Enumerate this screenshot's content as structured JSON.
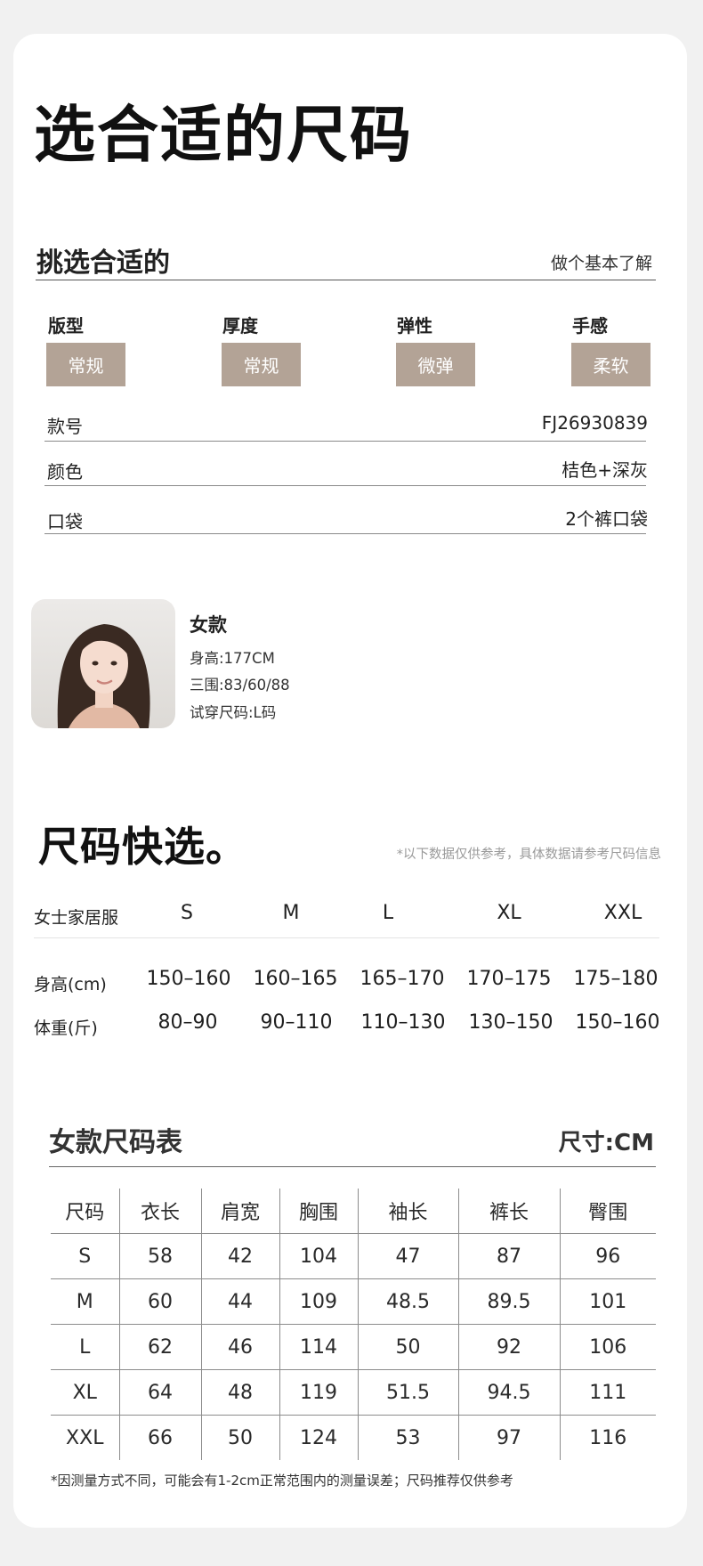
{
  "title": "选合适的尺码",
  "section": {
    "title": "挑选合适的",
    "link": "做个基本了解"
  },
  "attributes": [
    {
      "label": "版型",
      "value": "常规"
    },
    {
      "label": "厚度",
      "value": "常规"
    },
    {
      "label": "弹性",
      "value": "微弹"
    },
    {
      "label": "手感",
      "value": "柔软"
    }
  ],
  "specs": [
    {
      "label": "款号",
      "value": "FJ26930839"
    },
    {
      "label": "颜色",
      "value": "桔色+深灰"
    },
    {
      "label": "口袋",
      "value": "2个裤口袋"
    }
  ],
  "model": {
    "name": "女款",
    "height": "身高:177CM",
    "measurements": "三围:83/60/88",
    "size": "试穿尺码:L码"
  },
  "quick_select": {
    "title": "尺码快选。",
    "note": "*以下数据仅供参考，具体数据请参考尺码信息",
    "header_label": "女士家居服",
    "sizes": [
      "S",
      "M",
      "L",
      "XL",
      "XXL"
    ],
    "rows": [
      {
        "label": "身高(cm)",
        "values": [
          "150–160",
          "160–165",
          "165–170",
          "170–175",
          "175–180"
        ]
      },
      {
        "label": "体重(斤)",
        "values": [
          "80–90",
          "90–110",
          "110–130",
          "130–150",
          "150–160"
        ]
      }
    ]
  },
  "size_table": {
    "title": "女款尺码表",
    "unit": "尺寸:CM",
    "columns": [
      "尺码",
      "衣长",
      "肩宽",
      "胸围",
      "袖长",
      "裤长",
      "臀围"
    ],
    "rows": [
      [
        "S",
        "58",
        "42",
        "104",
        "47",
        "87",
        "96"
      ],
      [
        "M",
        "60",
        "44",
        "109",
        "48.5",
        "89.5",
        "101"
      ],
      [
        "L",
        "62",
        "46",
        "114",
        "50",
        "92",
        "106"
      ],
      [
        "XL",
        "64",
        "48",
        "119",
        "51.5",
        "94.5",
        "111"
      ],
      [
        "XXL",
        "66",
        "50",
        "124",
        "53",
        "97",
        "116"
      ]
    ]
  },
  "footnote": "*因测量方式不同，可能会有1-2cm正常范围内的测量误差；尺码推荐仅供参考",
  "colors": {
    "badge": "#b3a396",
    "background": "#f1f1f1",
    "card": "#ffffff"
  }
}
